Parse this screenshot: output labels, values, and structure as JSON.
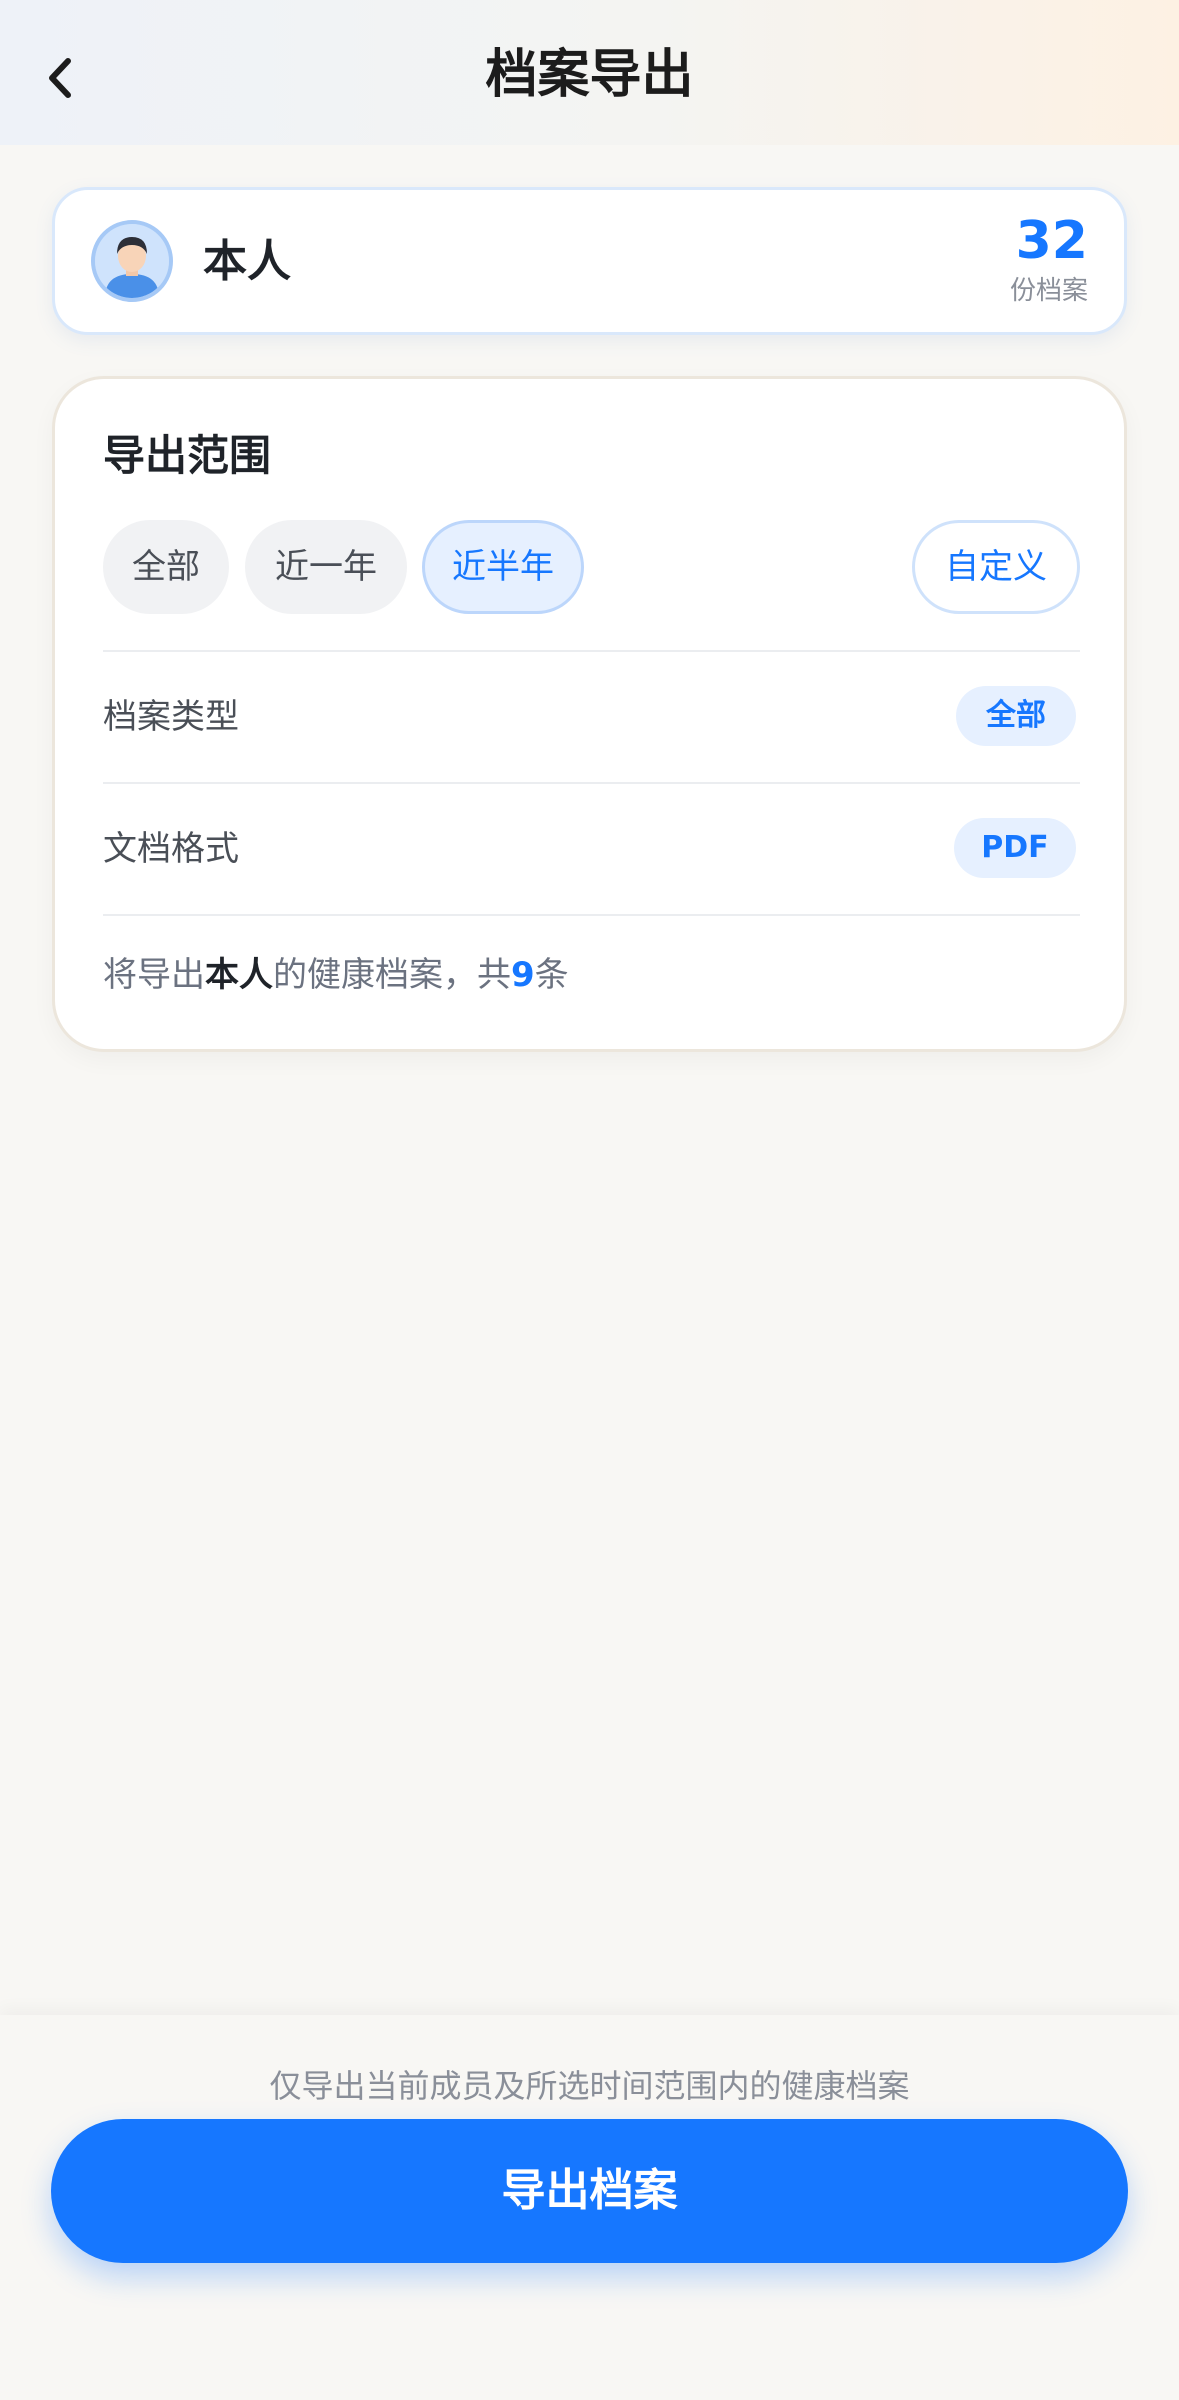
{
  "header": {
    "title": "档案导出",
    "back_icon": "chevron-left-icon"
  },
  "member": {
    "name": "本人",
    "record_count": "32",
    "record_unit": "份档案",
    "avatar_icon": "user-avatar-icon"
  },
  "range": {
    "title": "导出范围",
    "options": [
      {
        "label": "全部",
        "selected": false
      },
      {
        "label": "近一年",
        "selected": false
      },
      {
        "label": "近半年",
        "selected": true
      },
      {
        "label": "自定义",
        "selected": false
      }
    ],
    "archive_type": {
      "label": "档案类型",
      "value": "全部"
    },
    "doc_format": {
      "label": "文档格式",
      "value": "PDF"
    },
    "summary": {
      "prefix": "将导出",
      "member": "本人",
      "middle": "的健康档案，共",
      "count": "9",
      "suffix": "条"
    }
  },
  "footer": {
    "note": "仅导出当前成员及所选时间范围内的健康档案",
    "export_button": "导出档案"
  },
  "colors": {
    "accent": "#1677ff",
    "accent_bg": "#e6f0ff",
    "page_bg": "#f8f7f4"
  }
}
